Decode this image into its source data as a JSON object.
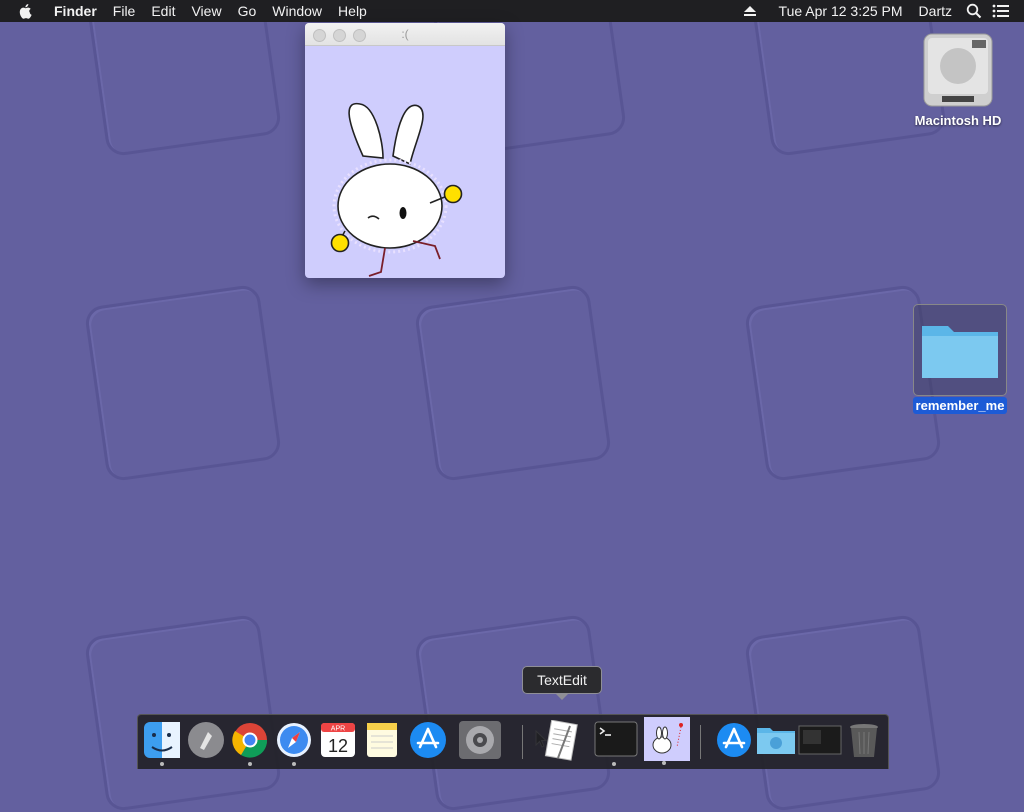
{
  "menubar": {
    "app_name": "Finder",
    "items": [
      "File",
      "Edit",
      "View",
      "Go",
      "Window",
      "Help"
    ],
    "datetime": "Tue Apr 12  3:25 PM",
    "user": "Dartz"
  },
  "window": {
    "title": ":("
  },
  "desktop_icons": {
    "hd_label": "Macintosh HD",
    "folder_label": "remember_me"
  },
  "tooltip": {
    "text": "TextEdit"
  },
  "dock": {
    "calendar_month": "APR",
    "calendar_day": "12",
    "items": [
      "finder-icon",
      "launchpad-icon",
      "chrome-icon",
      "safari-icon",
      "calendar-icon",
      "notes-icon",
      "app-store-icon",
      "system-preferences-icon",
      "textedit-icon",
      "terminal-icon",
      "bunny-app-icon",
      "app-store-icon",
      "downloads-folder-icon",
      "screen-icon",
      "trash-icon"
    ]
  },
  "colors": {
    "wallpaper": "#63609f",
    "window_bg": "#cfcdfd",
    "selection": "#1d5bd6"
  }
}
